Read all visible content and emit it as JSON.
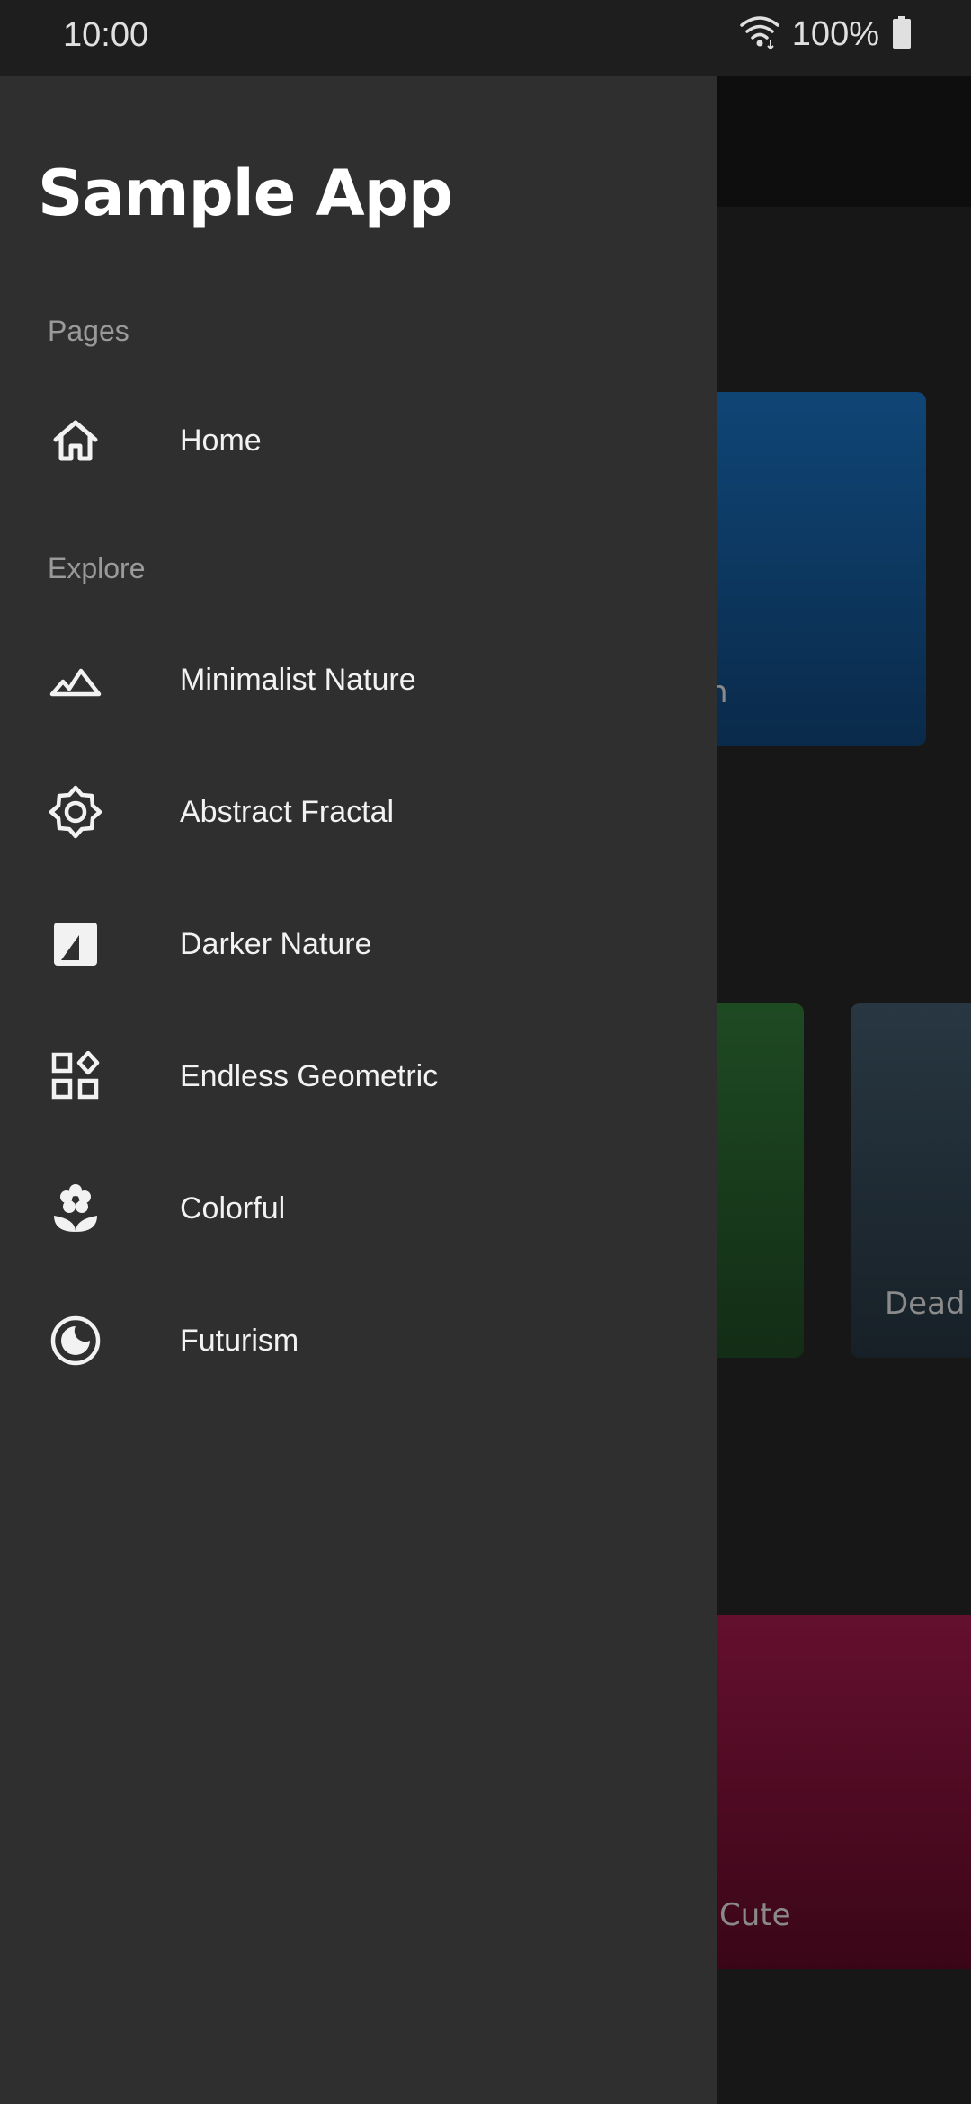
{
  "status_bar": {
    "time": "10:00",
    "battery": "100%",
    "icons": [
      "wifi-icon",
      "battery-icon"
    ]
  },
  "background": {
    "cards": [
      {
        "label": "n",
        "color": "#0f4576"
      },
      {
        "label": "",
        "color": "#1e4a22"
      },
      {
        "label": "Dead I",
        "color": "#283742"
      },
      {
        "label": "Cute",
        "color": "#640f2e"
      }
    ]
  },
  "drawer": {
    "title": "Sample App",
    "sections": {
      "pages": "Pages",
      "explore": "Explore"
    },
    "items": [
      {
        "label": "Home",
        "icon": "home-icon"
      },
      {
        "label": "Minimalist Nature",
        "icon": "mountain-icon"
      },
      {
        "label": "Abstract Fractal",
        "icon": "gear-sun-icon"
      },
      {
        "label": "Darker Nature",
        "icon": "image-icon"
      },
      {
        "label": "Endless Geometric",
        "icon": "shapes-icon"
      },
      {
        "label": "Colorful",
        "icon": "flower-icon"
      },
      {
        "label": "Futurism",
        "icon": "moon-circle-icon"
      }
    ]
  },
  "colors": {
    "drawer_bg": "#2f2f2f",
    "text_primary": "#f2f2f2",
    "text_secondary": "#9a9a9a"
  }
}
